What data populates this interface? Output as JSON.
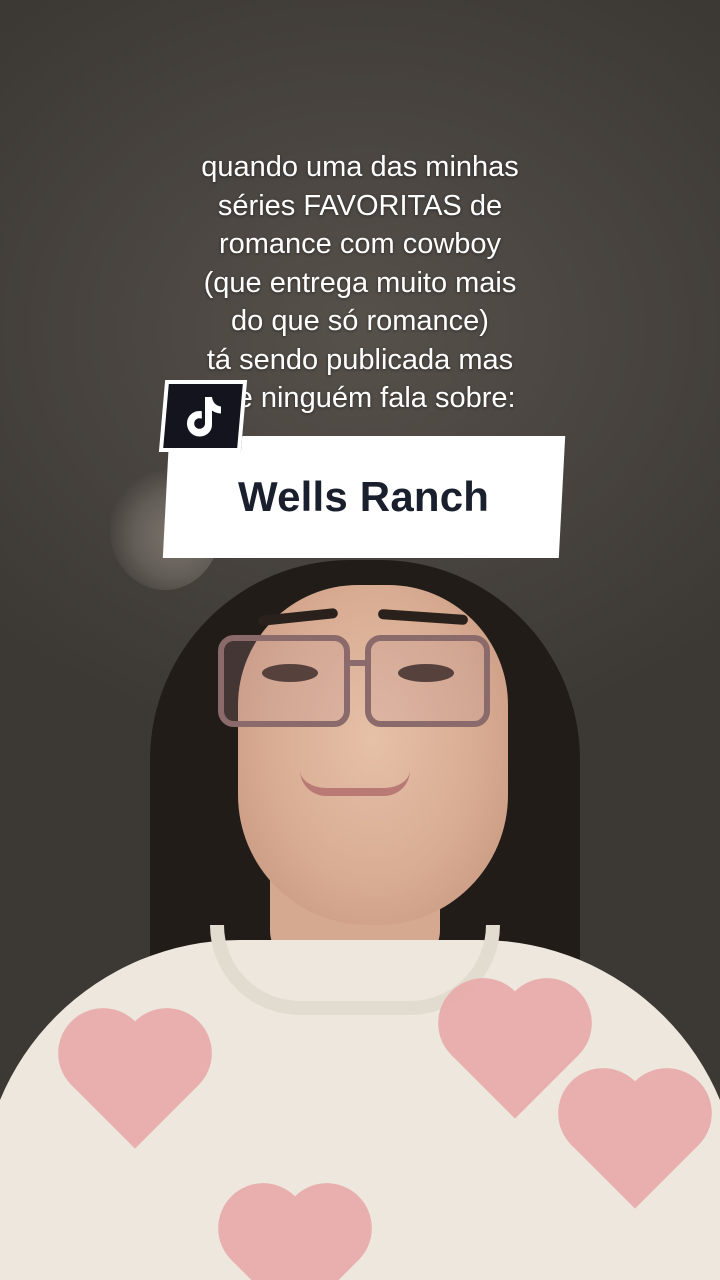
{
  "overlay": {
    "caption_lines": [
      "quando uma das minhas",
      "séries FAVORITAS de",
      "romance com cowboy",
      "(que entrega muito mais",
      "do que só romance)",
      "tá sendo publicada mas",
      "que ninguém fala sobre:"
    ],
    "title_card": "Wells Ranch",
    "app_logo": "tiktok-icon"
  },
  "colors": {
    "card_background": "#ffffff",
    "card_text": "#1a1f2e",
    "badge_background": "#14141f",
    "caption_text": "#ffffff"
  }
}
